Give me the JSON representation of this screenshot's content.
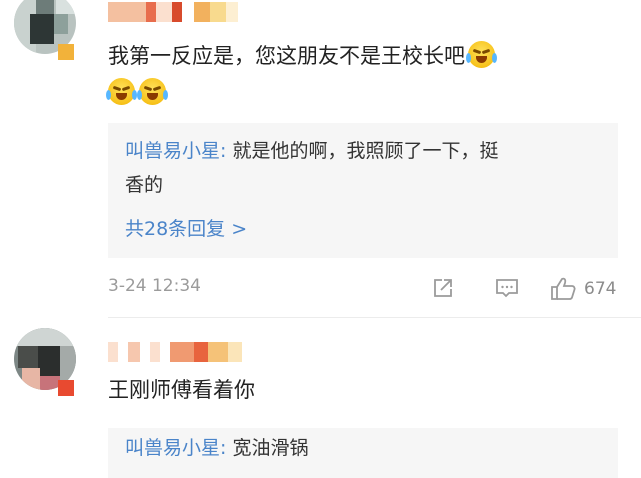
{
  "comments": [
    {
      "text": "我第一反应是，您这朋友不是王校长吧",
      "reply": {
        "replier": "叫兽易小星",
        "separator": ":",
        "line1": "就是他的啊，我照顾了一下，挺",
        "line2": "香的"
      },
      "more_replies": "共28条回复 >",
      "timestamp": "3-24 12:34",
      "like_count": "674",
      "icons": [
        "share-icon",
        "comment-icon",
        "like-icon"
      ]
    },
    {
      "text": "王刚师傅看着你",
      "reply": {
        "replier": "叫兽易小星",
        "separator": ":",
        "line1": "宽油滑锅"
      }
    }
  ],
  "colors": {
    "link": "#4a84c9",
    "meta": "#9b9b9b",
    "reply_bg": "#f6f6f6"
  }
}
